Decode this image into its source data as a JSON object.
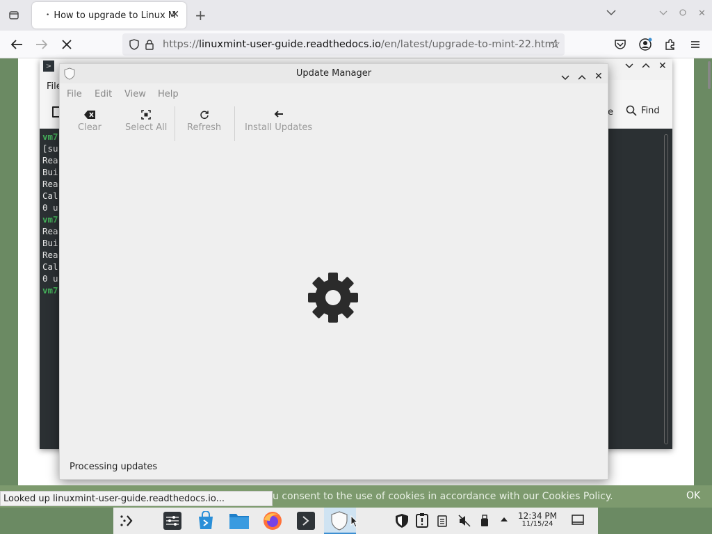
{
  "browser": {
    "tab_title": "How to upgrade to Linux M",
    "url_protocol": "https://",
    "url_domain": "linuxmint-user-guide.readthedocs.io",
    "url_path": "/en/latest/upgrade-to-mint-22.html"
  },
  "terminal": {
    "menu_file": "File",
    "find_label": "Find",
    "e_label": "e",
    "lines": [
      "vm7",
      "[su",
      "Rea",
      "Bui",
      "Rea",
      "Cal",
      "0 u",
      "vm7",
      "Rea",
      "Bui",
      "Rea",
      "Cal",
      "0 u",
      "vm7"
    ]
  },
  "update_manager": {
    "title": "Update Manager",
    "menu": [
      "File",
      "Edit",
      "View",
      "Help"
    ],
    "toolbar": {
      "clear": "Clear",
      "select_all": "Select All",
      "refresh": "Refresh",
      "install_updates": "Install Updates"
    },
    "status": "Processing updates"
  },
  "cookie_bar": {
    "text": "u consent to the use of cookies in accordance with our Cookies Policy.",
    "ok": "OK"
  },
  "status_popup": "Looked up linuxmint-user-guide.readthedocs.io...",
  "taskbar": {
    "clock_time": "12:34 PM",
    "clock_date": "11/15/24"
  },
  "colors": {
    "desktop_green": "#6b8a63",
    "terminal_bg": "#2b3033",
    "prompt_green": "#45b05a",
    "active_task": "#cfe3f2"
  }
}
